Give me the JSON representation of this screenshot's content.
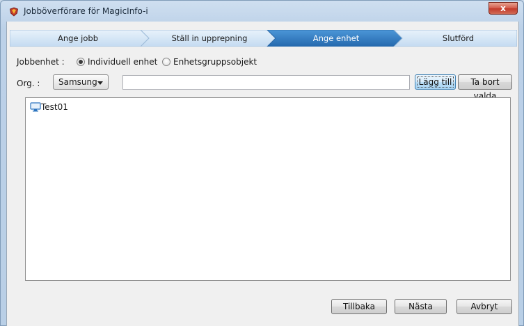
{
  "window": {
    "title": "Jobböverförare för MagicInfo-i",
    "close_label": "x"
  },
  "steps": [
    {
      "label": "Ange jobb",
      "active": false
    },
    {
      "label": "Ställ in upprepning",
      "active": false
    },
    {
      "label": "Ange enhet",
      "active": true
    },
    {
      "label": "Slutförd",
      "active": false
    }
  ],
  "job_unit": {
    "label": "Jobbenhet :",
    "options": [
      {
        "label": "Individuell enhet",
        "checked": true
      },
      {
        "label": "Enhetsgruppsobjekt",
        "checked": false
      }
    ]
  },
  "org": {
    "label": "Org. :",
    "selected": "Samsung",
    "input_value": "",
    "add_label": "Lägg till",
    "remove_label": "Ta bort valda"
  },
  "devices": [
    {
      "name": "Test01"
    }
  ],
  "footer": {
    "back_label": "Tillbaka",
    "next_label": "Nästa",
    "cancel_label": "Avbryt"
  },
  "colors": {
    "step_active": "#2e7bc4",
    "step_inactive": "#cfe2f5",
    "close_red": "#c9402f"
  },
  "icons": {
    "app": "magicinfo-shield-icon",
    "device": "monitor-icon",
    "dropdown": "chevron-down-icon"
  }
}
